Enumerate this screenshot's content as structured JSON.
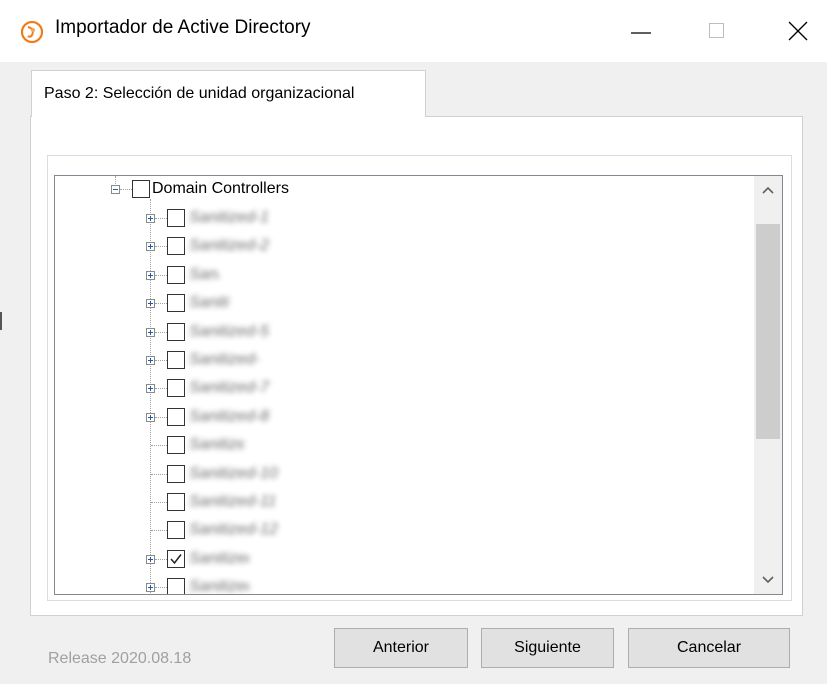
{
  "window": {
    "title": "Importador de Active Directory",
    "icon": "app-logo-icon",
    "controls": [
      "minimize-icon",
      "maximize-icon",
      "close-icon"
    ]
  },
  "tab": {
    "label": "Paso 2: Selección de unidad organizacional"
  },
  "tree": {
    "root": {
      "label": "Domain Controllers",
      "expanded": true,
      "checked": false
    },
    "children": [
      {
        "label": "Sanitized-1",
        "expandable": true,
        "checked": false
      },
      {
        "label": "Sanitized-2",
        "expandable": true,
        "checked": false
      },
      {
        "label": "Sanitized-3",
        "expandable": true,
        "checked": false
      },
      {
        "label": "Sanitized-4",
        "expandable": true,
        "checked": false
      },
      {
        "label": "Sanitized-5",
        "expandable": true,
        "checked": false
      },
      {
        "label": "Sanitized-6",
        "expandable": true,
        "checked": false
      },
      {
        "label": "Sanitized-7",
        "expandable": true,
        "checked": false
      },
      {
        "label": "Sanitized-8",
        "expandable": true,
        "checked": false
      },
      {
        "label": "Sanitized-9",
        "expandable": false,
        "checked": false
      },
      {
        "label": "Sanitized-10",
        "expandable": false,
        "checked": false
      },
      {
        "label": "Sanitized-11",
        "expandable": false,
        "checked": false
      },
      {
        "label": "Sanitized-12",
        "expandable": false,
        "checked": false
      },
      {
        "label": "Sanitized-13",
        "expandable": true,
        "checked": true
      },
      {
        "label": "Sanitized-14",
        "expandable": true,
        "checked": false
      }
    ]
  },
  "footer": {
    "release": "Release 2020.08.18",
    "prev_label": "Anterior",
    "next_label": "Siguiente",
    "cancel_label": "Cancelar"
  }
}
